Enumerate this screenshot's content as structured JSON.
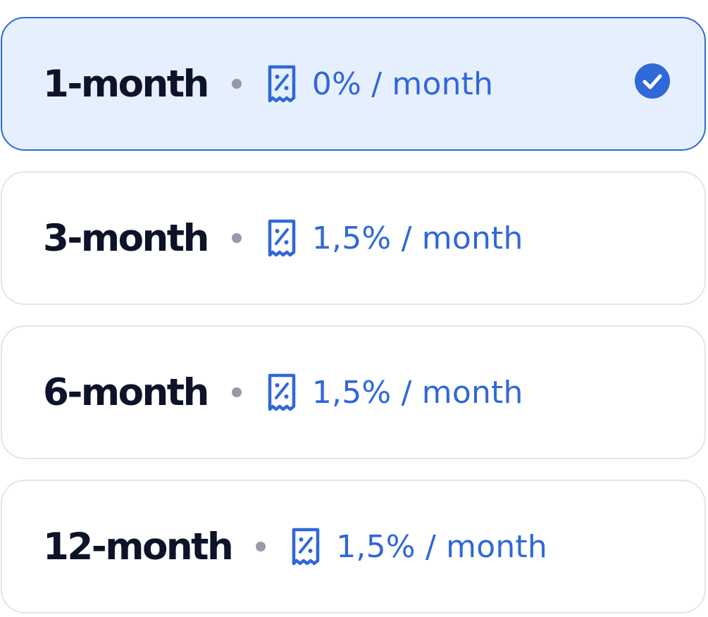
{
  "colors": {
    "accent": "#2f68d8",
    "selected_background": "#e6effd",
    "selected_border": "#2f68d8",
    "default_border": "#e3e5e8",
    "term_text": "#0d1328",
    "separator_dot": "#959aa6"
  },
  "icons": {
    "rate": "receipt-percent-icon",
    "selected": "check-circle-icon"
  },
  "plans": [
    {
      "term": "1-month",
      "rate": "0% / month",
      "selected": true
    },
    {
      "term": "3-month",
      "rate": "1,5% / month",
      "selected": false
    },
    {
      "term": "6-month",
      "rate": "1,5% / month",
      "selected": false
    },
    {
      "term": "12-month",
      "rate": "1,5% / month",
      "selected": false
    }
  ]
}
